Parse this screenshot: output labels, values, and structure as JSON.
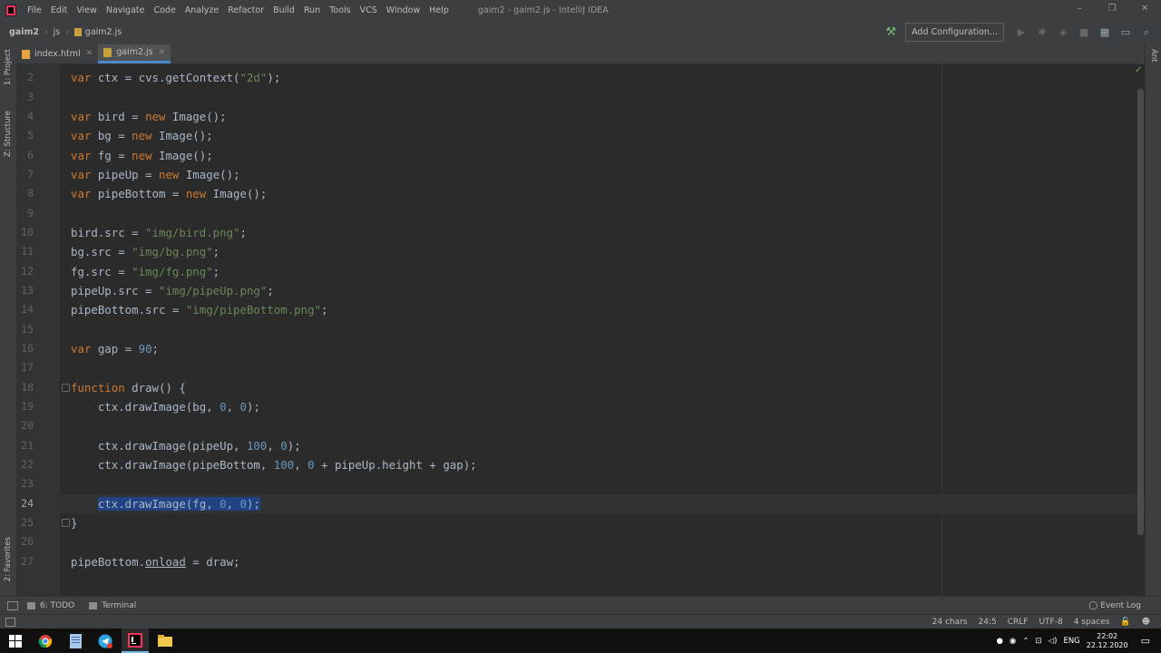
{
  "menubar": {
    "items": [
      "File",
      "Edit",
      "View",
      "Navigate",
      "Code",
      "Analyze",
      "Refactor",
      "Build",
      "Run",
      "Tools",
      "VCS",
      "Window",
      "Help"
    ],
    "title": "gaim2 - gaim2.js - IntelliJ IDEA"
  },
  "window_controls": [
    "–",
    "❐",
    "✕"
  ],
  "breadcrumb": {
    "project": "gaim2",
    "folder": "js",
    "file": "gaim2.js"
  },
  "toolbar": {
    "add_config_label": "Add Configuration..."
  },
  "tabs": [
    {
      "label": "index.html",
      "icon": "html-file-icon",
      "active": false
    },
    {
      "label": "gaim2.js",
      "icon": "js-file-icon",
      "active": true
    }
  ],
  "left_stripe": {
    "project": "1: Project",
    "structure": "Z: Structure",
    "favorites": "2: Favorites"
  },
  "right_stripe": {
    "ant": "Ant"
  },
  "editor": {
    "line_numbers": [
      "2",
      "3",
      "4",
      "5",
      "6",
      "7",
      "8",
      "9",
      "10",
      "11",
      "12",
      "13",
      "14",
      "15",
      "16",
      "17",
      "18",
      "19",
      "20",
      "21",
      "22",
      "23",
      "24",
      "25",
      "26",
      "27"
    ],
    "current_line": "24",
    "code": {
      "l2_var": "var",
      "l2_rest": " ctx = cvs.getContext(",
      "l2_str": "\"2d\"",
      "l2_end": ");",
      "kw_var": "var",
      "kw_new": "new",
      "image_ctor": " Image();",
      "l4_name": " bird = ",
      "l5_name": " bg = ",
      "l6_name": " fg = ",
      "l7_name": " pipeUp = ",
      "l8_name": " pipeBottom = ",
      "l10_a": "bird.src = ",
      "l10_s": "\"img/bird.png\"",
      "semi": ";",
      "l11_a": "bg.src = ",
      "l11_s": "\"img/bg.png\"",
      "l12_a": "fg.src = ",
      "l12_s": "\"img/fg.png\"",
      "l13_a": "pipeUp.src = ",
      "l13_s": "\"img/pipeUp.png\"",
      "l14_a": "pipeBottom.src = ",
      "l14_s": "\"img/pipeBottom.png\"",
      "l16_a": " gap = ",
      "l16_n": "90",
      "l18_kw": "function",
      "l18_rest": " draw() {",
      "l19_a": "    ctx.drawImage(bg, ",
      "n0": "0",
      "comma": ", ",
      "close": ");",
      "l21_a": "    ctx.drawImage(pipeUp, ",
      "n100": "100",
      "l22_a": "    ctx.drawImage(pipeBottom, ",
      "l22_b": " + pipeUp.height + gap);",
      "l24_indent": "    ",
      "l24_a": "ctx.drawImage(fg, ",
      "l25": "}",
      "l27_a": "pipeBottom.",
      "l27_b": "onload",
      "l27_c": " = draw;"
    }
  },
  "bottom_tools": {
    "todo": "6: TODO",
    "terminal": "Terminal",
    "event_log": "Event Log"
  },
  "status": {
    "chars": "24 chars",
    "position": "24:5",
    "line_sep": "CRLF",
    "encoding": "UTF-8",
    "indent": "4 spaces"
  },
  "taskbar": {
    "lang": "ENG",
    "time": "22:02",
    "date": "22.12.2020"
  }
}
